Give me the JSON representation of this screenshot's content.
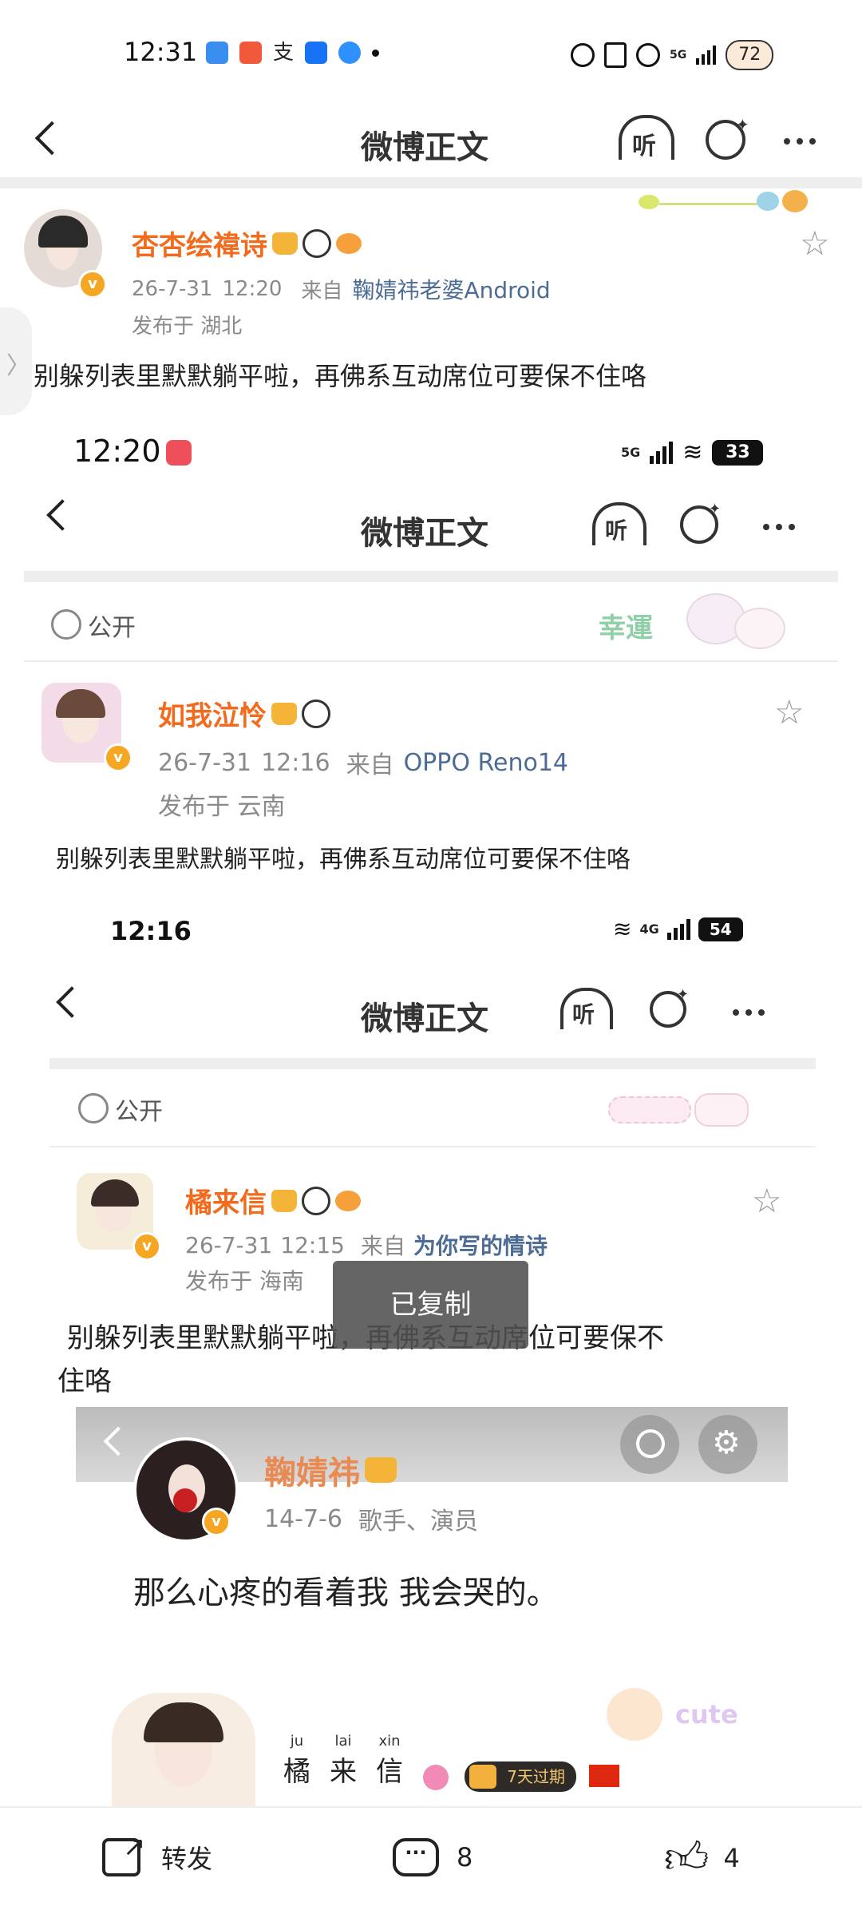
{
  "status_bar": {
    "time": "12:31",
    "network": "5G",
    "battery": "72"
  },
  "header": {
    "title": "微博正文",
    "listen_label": "听"
  },
  "post": {
    "username": "杏杏绘禕诗",
    "date": "26-7-31",
    "time": "12:20",
    "from_label": "来自",
    "source": "鞠婧祎老婆Android",
    "location": "发布于 湖北",
    "text": "别躲列表里默默躺平啦，再佛系互动席位可要保不住咯"
  },
  "shot1": {
    "status_time": "12:20",
    "network": "5G",
    "battery": "33",
    "title": "微博正文",
    "listen_label": "听",
    "visibility": "公开",
    "sticker": "幸運",
    "username": "如我泣怜",
    "date": "26-7-31",
    "time": "12:16",
    "from_label": "来自",
    "source": "OPPO Reno14",
    "location": "发布于 云南",
    "text": "别躲列表里默默躺平啦，再佛系互动席位可要保不住咯"
  },
  "shot2": {
    "status_time": "12:16",
    "network": "4G",
    "battery": "54",
    "title": "微博正文",
    "listen_label": "听",
    "visibility": "公开",
    "username": "橘来信",
    "date": "26-7-31",
    "time": "12:15",
    "from_label": "来自",
    "source": "为你写的情诗",
    "location": "发布于 海南",
    "text_line1": "别躲列表里默默躺平啦，再佛系互动席位可要保不",
    "text_line2": "住咯",
    "toast": "已复制"
  },
  "shot3": {
    "username": "鞠婧祎",
    "meta": "14-7-6",
    "role": "歌手、演员",
    "text": "那么心疼的看着我 我会哭的。"
  },
  "banner": {
    "name_chars": [
      "橘",
      "来",
      "信"
    ],
    "name_pinyin": [
      "ju",
      "lai",
      "xin"
    ],
    "vip_label": "7天过期",
    "cute_label": "cute"
  },
  "toolbar": {
    "repost_label": "转发",
    "comment_count": "8",
    "like_count": "4"
  },
  "colors": {
    "accent": "#f26a1b",
    "link": "#4d6c95",
    "vip_badge": "#f5a623"
  }
}
